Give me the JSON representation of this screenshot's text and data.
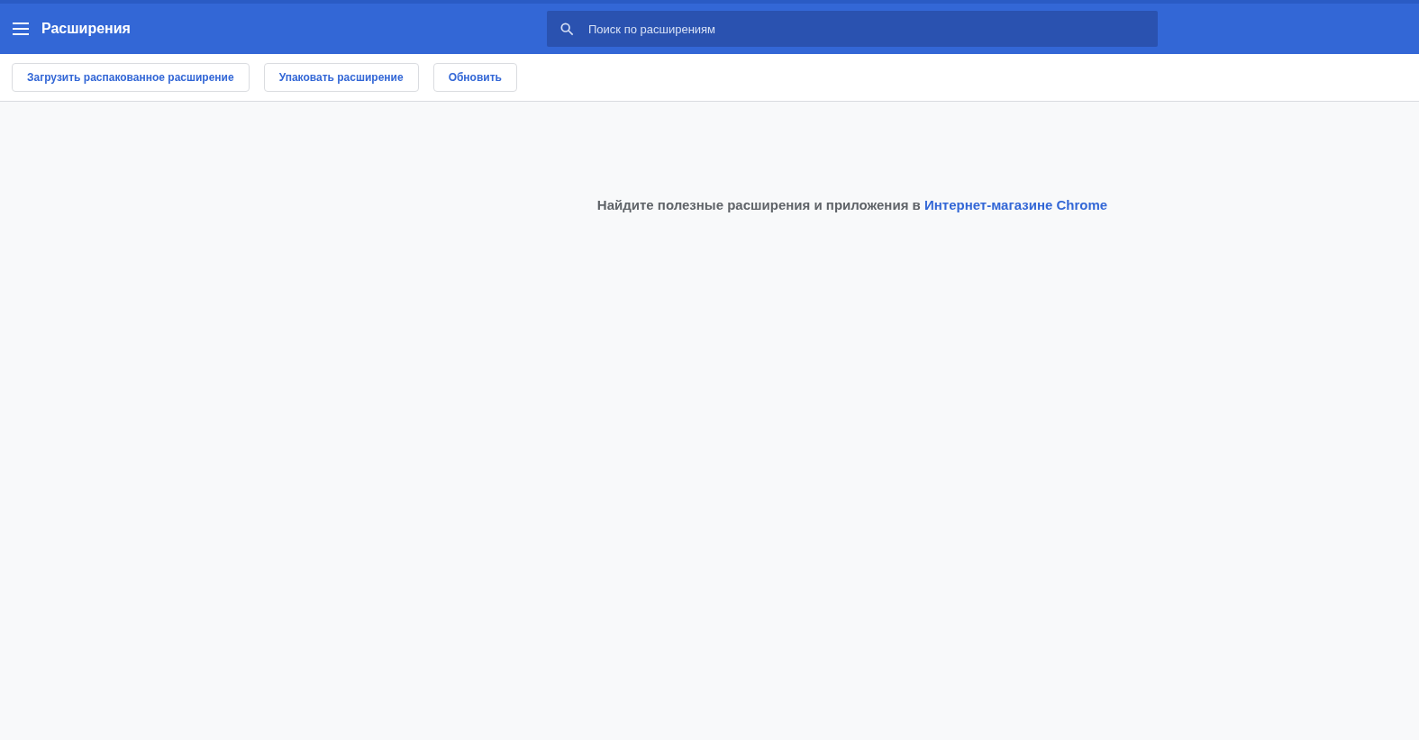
{
  "header": {
    "title": "Расширения",
    "search": {
      "placeholder": "Поиск по расширениям"
    }
  },
  "toolbar": {
    "buttons": [
      "Загрузить распакованное расширение",
      "Упаковать расширение",
      "Обновить"
    ]
  },
  "message": {
    "text": "Найдите полезные расширения и приложения в",
    "link": "Интернет-магазине Chrome"
  }
}
